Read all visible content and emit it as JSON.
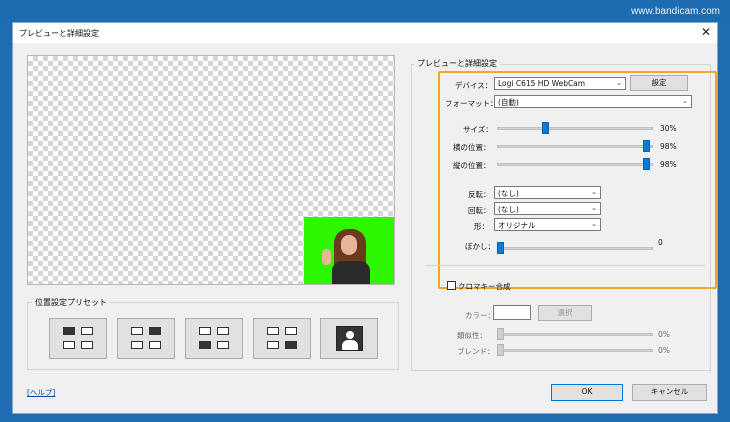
{
  "watermark": "www.bandicam.com",
  "dialog": {
    "title": "プレビューと詳細設定",
    "close_icon": "close-icon"
  },
  "presets": {
    "label": "位置設定プリセット",
    "items": [
      "top-left",
      "top-right",
      "bottom-left",
      "bottom-right",
      "fullscreen"
    ]
  },
  "settings": {
    "group_label": "プレビューと詳細設定",
    "device_label": "デバイス：",
    "device_value": "Logi C615 HD WebCam",
    "device_settings_button": "設定",
    "format_label": "フォーマット：",
    "format_value": "(自動)",
    "size_label": "サイズ：",
    "size_pct": "30%",
    "size_value": 0.3,
    "hpos_label": "横の位置：",
    "hpos_pct": "98%",
    "hpos_value": 0.98,
    "vpos_label": "縦の位置：",
    "vpos_pct": "98%",
    "vpos_value": 0.98,
    "flip_label": "反転：",
    "flip_value": "(なし)",
    "rotate_label": "回転：",
    "rotate_value": "(なし)",
    "shape_label": "形：",
    "shape_value": "オリジナル",
    "blur_label": "ぼかし：",
    "blur_value_text": "0",
    "blur_value": 0
  },
  "chroma": {
    "checkbox_label": "クロマキー合成",
    "color_label": "カラー：",
    "select_button": "選択",
    "similarity_label": "類似性：",
    "similarity_pct": "0%",
    "blend_label": "ブレンド：",
    "blend_pct": "0%"
  },
  "footer": {
    "help_link": "[ヘルプ]",
    "ok_button": "OK",
    "cancel_button": "キャンセル"
  },
  "colors": {
    "highlight": "#f5a623",
    "chroma_green": "#2ef500",
    "slider_thumb": "#0a7ad8",
    "desktop": "#1f6db0"
  }
}
